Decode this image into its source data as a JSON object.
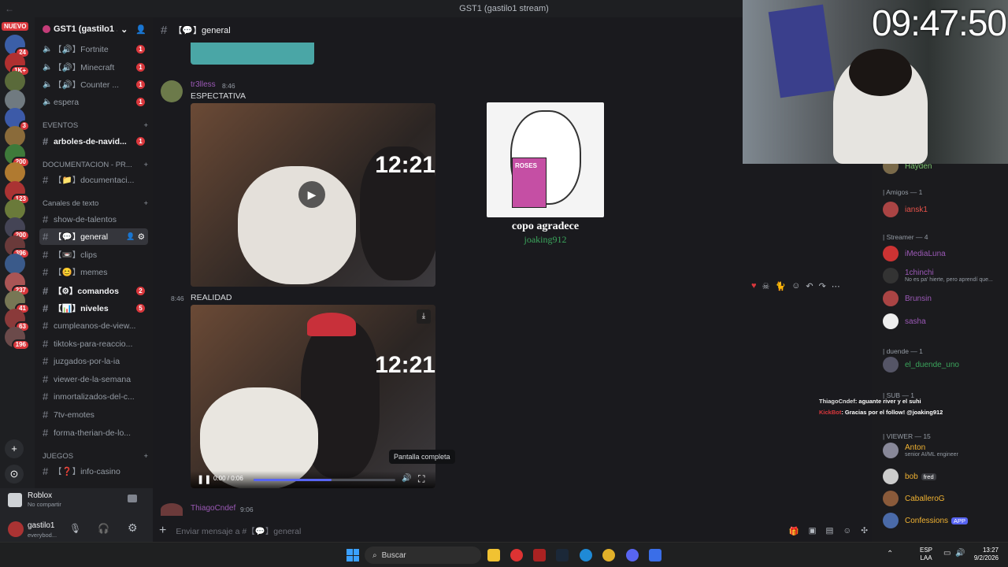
{
  "window": {
    "title": "GST1 (gastilo1 stream)"
  },
  "servers": {
    "new_label": "NUEVO",
    "badges": [
      "24",
      "1K+",
      "",
      "",
      "3",
      "",
      "200",
      "",
      "123",
      "",
      "200",
      "396",
      "",
      "237",
      "41",
      "63",
      "196"
    ]
  },
  "guild": {
    "name": "GST1 (gastilo1 ..."
  },
  "channels": [
    {
      "name": "【🔊】Fortnite",
      "type": "voice",
      "badge": "1"
    },
    {
      "name": "【🔊】Minecraft",
      "type": "voice",
      "badge": "1"
    },
    {
      "name": "【🔊】Counter ...",
      "type": "voice",
      "badge": "1"
    },
    {
      "name": "espera",
      "type": "voice",
      "badge": "1"
    },
    {
      "name": "arboles-de-navid...",
      "type": "text",
      "badge": "1",
      "unread": true
    },
    {
      "name": "【📁】documentaci...",
      "type": "text"
    },
    {
      "name": "show-de-talentos",
      "type": "text"
    },
    {
      "name": "【💬】general",
      "type": "text",
      "active": true
    },
    {
      "name": "【📼】clips",
      "type": "text"
    },
    {
      "name": "【😊】memes",
      "type": "text"
    },
    {
      "name": "【⚙】comandos",
      "type": "text",
      "badge": "2",
      "unread": true
    },
    {
      "name": "【📊】niveles",
      "type": "text",
      "badge": "5",
      "unread": true
    },
    {
      "name": "cumpleanos-de-view...",
      "type": "text"
    },
    {
      "name": "tiktoks-para-reaccio...",
      "type": "text"
    },
    {
      "name": "juzgados-por-la-ia",
      "type": "text"
    },
    {
      "name": "viewer-de-la-semana",
      "type": "text"
    },
    {
      "name": "inmortalizados-del-c...",
      "type": "text"
    },
    {
      "name": "7tv-emotes",
      "type": "text"
    },
    {
      "name": "forma-therian-de-lo...",
      "type": "text"
    },
    {
      "name": "【❓】info-casino",
      "type": "text"
    }
  ],
  "categories": [
    "EVENTOS",
    "DOCUMENTACION - PR...",
    "Canales de texto",
    "JUEGOS"
  ],
  "activity": {
    "game": "Roblox",
    "status": "No compartir"
  },
  "user": {
    "name": "gastilo1",
    "status": "everybod..."
  },
  "chat": {
    "channel": "【💬】general",
    "author": "tr3lless",
    "time": "8:46",
    "text1": "ESPECTATIVA",
    "text2": "REALIDAD",
    "video_time": "0:00 / 0:06",
    "video_progress": 0.55,
    "clock_overlay": "12:21",
    "sticker_caption": "copo agradece",
    "sticker_author": "joaking912",
    "sticker_label": "ROSES",
    "next_author": "ThiagoCndef",
    "next_time": "9:06",
    "tooltip": "Pantalla completa",
    "composer_placeholder": "Enviar mensaje a #【💬】general"
  },
  "stream": {
    "clock": "09:47:50"
  },
  "overlay_chat": [
    {
      "user": "ThiagoCndef",
      "text": ": aguante river y el suhi"
    },
    {
      "user": "KickBot",
      "text": ": Gracias por el follow! @joaking912"
    }
  ],
  "members": {
    "groups": [
      "| Amigos — 1",
      "| Streamer — 4",
      "| duende — 1",
      "| SUB — 1",
      "| VIEWER — 15"
    ],
    "list": [
      {
        "name": "Hayden",
        "color": "#7cc46f"
      },
      {
        "name": "iansk1",
        "color": "#e8524a"
      },
      {
        "name": "iMediaLuna",
        "color": "#9b59b6"
      },
      {
        "name": "1chinchi",
        "color": "#9b59b6",
        "sub": "No es pa' hierte, pero aprendí que..."
      },
      {
        "name": "Brunsin",
        "color": "#9b59b6"
      },
      {
        "name": "sasha",
        "color": "#9b59b6"
      },
      {
        "name": "el_duende_uno",
        "color": "#3ba55c"
      },
      {
        "name": "Anton",
        "color": "#f0b232",
        "sub": "senior AI/ML engineer"
      },
      {
        "name": "bob",
        "color": "#f0b232",
        "tag": "fred"
      },
      {
        "name": "CaballeroG",
        "color": "#f0b232"
      },
      {
        "name": "Confessions",
        "color": "#f0b232",
        "tag": "APP"
      }
    ]
  },
  "taskbar": {
    "search": "Buscar",
    "lang1": "ESP",
    "lang2": "LAA",
    "time": "13:27",
    "date": "9/2/2026"
  }
}
